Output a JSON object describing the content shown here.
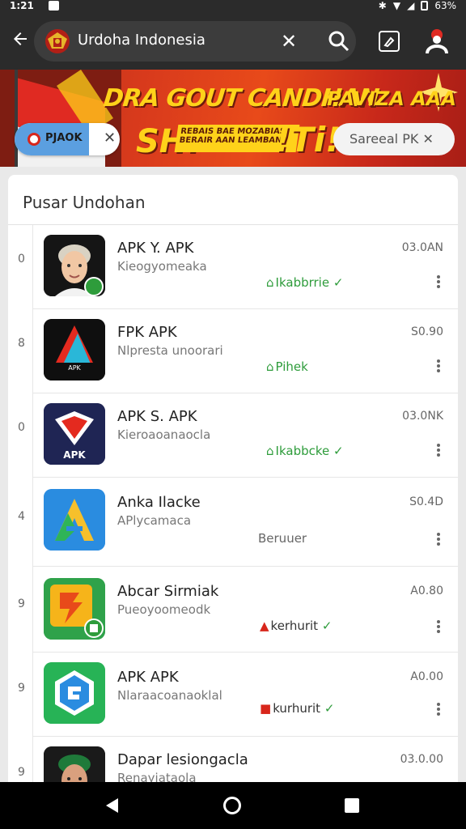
{
  "status_bar": {
    "time": "1:21",
    "battery": "63%"
  },
  "app_bar": {
    "url_text": "Urdoha Indonesia",
    "clear_symbol": "✕",
    "icons": [
      "back-arrow-icon",
      "emblem-icon",
      "close-icon",
      "search-icon",
      "tabs-icon",
      "profile-icon"
    ]
  },
  "banner": {
    "line1": "DRA GOUT CANDHAN",
    "line1b": "PAVIZA AAA",
    "big_left": "SH!",
    "small_text": "REBAIS BAE MOZABIAS BERAIR AAN LEAMBANT",
    "big_right": "!Ti!",
    "chip_left_label": "PJAOK",
    "chip_left_close": "✕",
    "chip_right_label": "Sareeal PK ✕"
  },
  "list": {
    "title": "Pusar Undohan",
    "items": [
      {
        "side": "0",
        "name": "APK Y. APK",
        "sub": "Kieogyomeaka",
        "time": "03.0AN",
        "status": "Ikabbrrie",
        "status_type": "green",
        "icon": "person-avatar-icon"
      },
      {
        "side": "8",
        "name": "FPK APK",
        "sub": "Nlpresta unoorari",
        "time": "S0.90",
        "status": "Pihek",
        "status_type": "green",
        "icon": "triangle-logo-icon"
      },
      {
        "side": "0",
        "name": "APK S. APK",
        "sub": "Kieroaoanaocla",
        "time": "03.0NK",
        "status": "Ikabbcke",
        "status_type": "green",
        "icon": "apk-logo-icon"
      },
      {
        "side": "4",
        "name": "Anka Ilacke",
        "sub": "APlycamaca",
        "time": "S0.4D",
        "status": "Beruuer",
        "status_type": "gray",
        "icon": "a-logo-icon"
      },
      {
        "side": "9",
        "name": "Abcar Sirmiak",
        "sub": "Pueoyoomeodk",
        "time": "A0.80",
        "status": "kerhurit",
        "status_type": "red",
        "icon": "orange-app-icon"
      },
      {
        "side": "9",
        "name": "APK APK",
        "sub": "Nlaraacoanaoklal",
        "time": "A0.00",
        "status": "kurhurit",
        "status_type": "red",
        "icon": "blue-cube-icon"
      },
      {
        "side": "9",
        "name": "Dapar lesiongacla",
        "sub": "Renayiataola",
        "time": "03.0.00",
        "status": "",
        "status_type": "gray",
        "icon": "person-avatar-2-icon"
      }
    ]
  },
  "nav": {
    "icons": [
      "nav-back-icon",
      "nav-home-icon",
      "nav-recent-icon"
    ]
  }
}
